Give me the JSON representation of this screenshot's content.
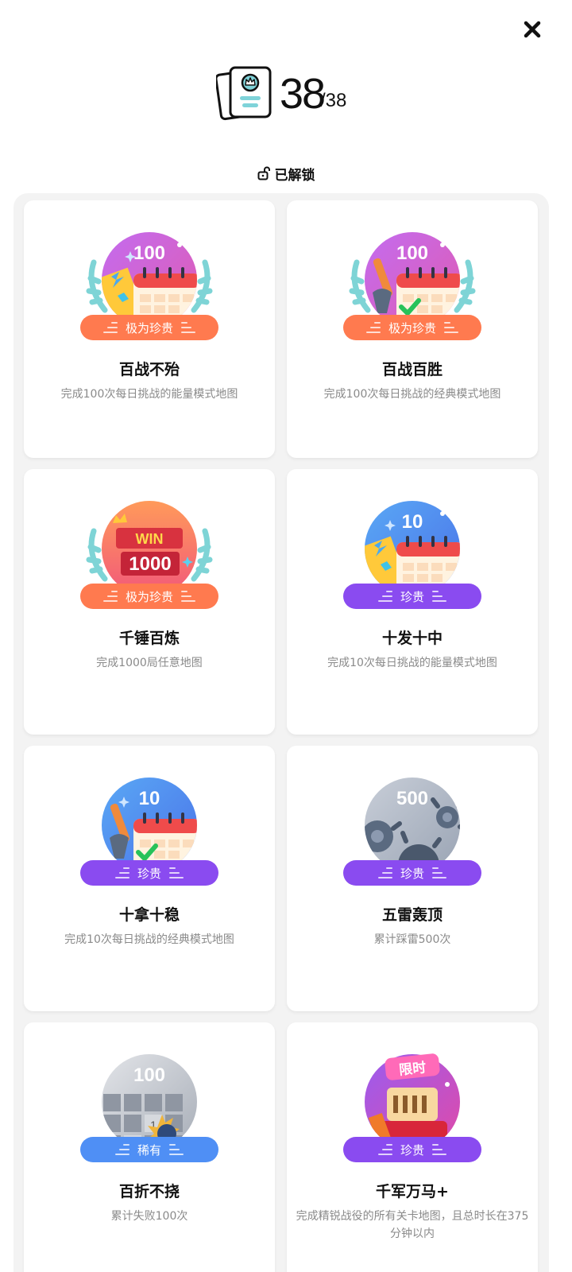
{
  "window": {
    "close_icon": "close-icon"
  },
  "header": {
    "count": "38",
    "total": "/38",
    "icon": "album-icon"
  },
  "unlock": {
    "label": "已解锁",
    "icon": "unlock-icon"
  },
  "colors": {
    "rarity_extreme": "#ff7a4f",
    "rarity_precious": "#8a4bf0",
    "rarity_rare": "#4f8ff5"
  },
  "achievements": [
    {
      "title": "百战不殆",
      "desc": "完成100次每日挑战的能量模式地图",
      "rarity": "极为珍贵",
      "badge_text": "100"
    },
    {
      "title": "百战百胜",
      "desc": "完成100次每日挑战的经典模式地图",
      "rarity": "极为珍贵",
      "badge_text": "100"
    },
    {
      "title": "千锤百炼",
      "desc": "完成1000局任意地图",
      "rarity": "极为珍贵",
      "badge_text": "1000",
      "badge_banner": "WIN"
    },
    {
      "title": "十发十中",
      "desc": "完成10次每日挑战的能量模式地图",
      "rarity": "珍贵",
      "badge_text": "10"
    },
    {
      "title": "十拿十稳",
      "desc": "完成10次每日挑战的经典模式地图",
      "rarity": "珍贵",
      "badge_text": "10"
    },
    {
      "title": "五雷轰顶",
      "desc": "累计踩雷500次",
      "rarity": "珍贵",
      "badge_text": "500"
    },
    {
      "title": "百折不挠",
      "desc": "累计失败100次",
      "rarity": "稀有",
      "badge_text": "100",
      "badge_cells": [
        "1",
        "2"
      ]
    },
    {
      "title": "千军万马+",
      "desc": "完成精锐战役的所有关卡地图，且总时长在375分钟以内",
      "rarity": "珍贵",
      "badge_text": "限时"
    }
  ]
}
